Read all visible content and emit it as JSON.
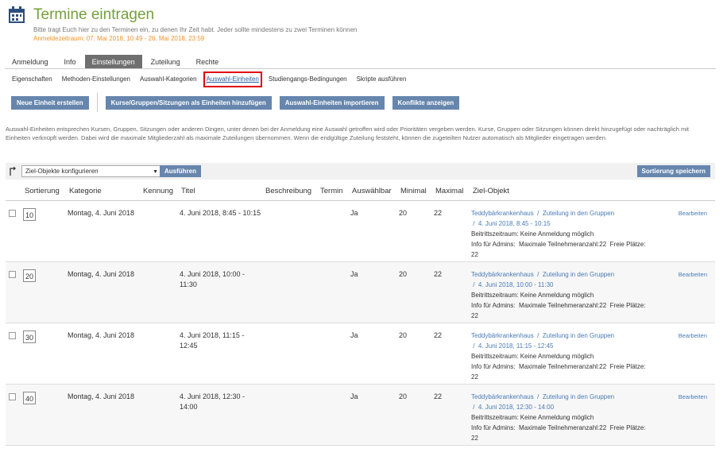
{
  "header": {
    "icon": "calendar-icon",
    "title": "Termine eintragen",
    "description": "Bitte tragt Euch hier zu den Terminen ein, zu denen Ihr Zeit habt. Jeder sollte mindestens zu zwei Terminen können",
    "period": "Anmeldezeitraum: 07. Mai 2018, 10:49 - 26. Mai 2018, 23:59"
  },
  "tabs": [
    {
      "label": "Anmeldung",
      "active": false
    },
    {
      "label": "Info",
      "active": false
    },
    {
      "label": "Einstellungen",
      "active": true
    },
    {
      "label": "Zuteilung",
      "active": false
    },
    {
      "label": "Rechte",
      "active": false
    }
  ],
  "subnav": [
    {
      "label": "Eigenschaften"
    },
    {
      "label": "Methoden-Einstellungen"
    },
    {
      "label": "Auswahl-Kategorien"
    },
    {
      "label": "Auswahl-Einheiten",
      "active": true
    },
    {
      "label": "Studiengangs-Bedingungen"
    },
    {
      "label": "Skripte ausführen"
    }
  ],
  "toolbar": {
    "new_unit": "Neue Einheit erstellen",
    "add_courses": "Kurse/Gruppen/Sitzungen als Einheiten hinzufügen",
    "import_units": "Auswahl-Einheiten importieren",
    "show_conflicts": "Konflikte anzeigen"
  },
  "intro": "Auswahl-Einheiten entsprechen Kursen, Gruppen, Sitzungen oder anderen Dingen, unter denen bei der Anmeldung eine Auswahl getroffen wird oder Prioritäten vergeben werden. Kurse, Gruppen oder Sitzungen können direkt hinzugefügt oder nachträglich mit Einheiten verknüpft werden. Dabei wird die maximale Mitgliederzahl als maximale Zuteilungen übernommen. Wenn die endgültige Zuteilung feststeht, können die zugeteilten Nutzer automatisch als Mitglieder eingetragen werden.",
  "actionbar": {
    "arrow_icon": "corner-arrow-icon",
    "select_value": "Ziel-Objekte konfigurieren",
    "run_label": "Ausführen",
    "save_label": "Sortierung speichern"
  },
  "columns": [
    "Sortierung",
    "Kategorie",
    "Kennung",
    "Titel",
    "Beschreibung",
    "Termin",
    "Auswählbar",
    "Minimal",
    "Maximal",
    "Ziel-Objekt"
  ],
  "rows": [
    {
      "sort": "10",
      "category": "Montag, 4. Juni 2018",
      "id": "",
      "title": "4. Juni 2018, 8:45 - 10:15",
      "description": "",
      "date": "",
      "selectable": "Ja",
      "min": "20",
      "max": "22",
      "target_a": "Teddybärkrankenhaus",
      "target_b": "Zuteilung in den Gruppen",
      "target_c": "4. Juni 2018, 8:45 - 10:15",
      "period": "Beitrittszeitraum: Keine Anmeldung möglich",
      "info_admin": "Info für Admins:",
      "info_max": "Maximale Teilnehmeranzahl:22",
      "info_free": "Freie Plätze:",
      "info_free_val": "22",
      "edit": "Bearbeiten"
    },
    {
      "sort": "20",
      "category": "Montag, 4. Juni 2018",
      "id": "",
      "title": "4. Juni 2018, 10:00 - 11:30",
      "description": "",
      "date": "",
      "selectable": "Ja",
      "min": "20",
      "max": "22",
      "target_a": "Teddybärkrankenhaus",
      "target_b": "Zuteilung in den Gruppen",
      "target_c": "4. Juni 2018, 10:00 - 11:30",
      "period": "Beitrittszeitraum: Keine Anmeldung möglich",
      "info_admin": "Info für Admins:",
      "info_max": "Maximale Teilnehmeranzahl:22",
      "info_free": "Freie Plätze:",
      "info_free_val": "22",
      "edit": "Bearbeiten"
    },
    {
      "sort": "30",
      "category": "Montag, 4. Juni 2018",
      "id": "",
      "title": "4. Juni 2018, 11:15 - 12:45",
      "description": "",
      "date": "",
      "selectable": "Ja",
      "min": "20",
      "max": "22",
      "target_a": "Teddybärkrankenhaus",
      "target_b": "Zuteilung in den Gruppen",
      "target_c": "4. Juni 2018, 11:15 - 12:45",
      "period": "Beitrittszeitraum: Keine Anmeldung möglich",
      "info_admin": "Info für Admins:",
      "info_max": "Maximale Teilnehmeranzahl:22",
      "info_free": "Freie Plätze:",
      "info_free_val": "22",
      "edit": "Bearbeiten"
    },
    {
      "sort": "40",
      "category": "Montag, 4. Juni 2018",
      "id": "",
      "title": "4. Juni 2018, 12:30 - 14:00",
      "description": "",
      "date": "",
      "selectable": "Ja",
      "min": "20",
      "max": "22",
      "target_a": "Teddybärkrankenhaus",
      "target_b": "Zuteilung in den Gruppen",
      "target_c": "4. Juni 2018, 12:30 - 14:00",
      "period": "Beitrittszeitraum: Keine Anmeldung möglich",
      "info_admin": "Info für Admins:",
      "info_max": "Maximale Teilnehmeranzahl:22",
      "info_free": "Freie Plätze:",
      "info_free_val": "22",
      "edit": "Bearbeiten"
    }
  ],
  "colors": {
    "title_green": "#75a03a",
    "period_orange": "#f0932b",
    "button_blue": "#6786ad",
    "link_blue": "#4a7ab7",
    "highlight_red": "#e00000"
  }
}
